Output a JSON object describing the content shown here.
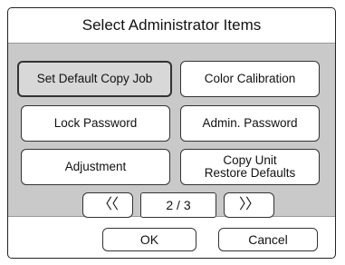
{
  "dialog": {
    "title": "Select Administrator Items",
    "items": [
      {
        "label": "Set Default Copy Job"
      },
      {
        "label": "Color Calibration"
      },
      {
        "label": "Lock Password"
      },
      {
        "label": "Admin. Password"
      },
      {
        "label": "Adjustment"
      },
      {
        "label_line1": "Copy Unit",
        "label_line2": "Restore Defaults"
      }
    ],
    "pager": {
      "prev_label": "〈〈",
      "page_indicator": "2 / 3",
      "next_label": "〉〉"
    },
    "footer": {
      "ok_label": "OK",
      "cancel_label": "Cancel"
    }
  }
}
